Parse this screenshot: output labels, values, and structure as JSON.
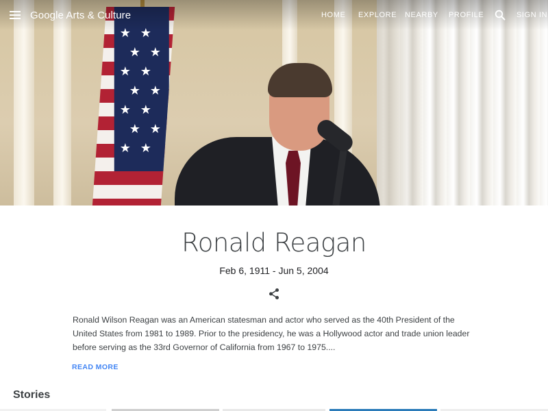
{
  "header": {
    "brand": "Google Arts & Culture",
    "nav": [
      "HOME",
      "EXPLORE",
      "NEARBY",
      "PROFILE"
    ],
    "sign_in": "SIGN IN"
  },
  "hero": {
    "image": "photo-of-ronald-reagan-at-podium-with-us-flag"
  },
  "entity": {
    "name": "Ronald Reagan",
    "dates": "Feb 6, 1911 - Jun 5, 2004",
    "bio": "Ronald Wilson Reagan was an American statesman and actor who served as the 40th President of the United States from 1981 to 1989. Prior to the presidency, he was a Hollywood actor and trade union leader before serving as the 33rd Governor of California from 1967 to 1975....",
    "read_more": "READ MORE"
  },
  "sections": {
    "stories_title": "Stories"
  },
  "colors": {
    "accent": "#4285f4",
    "text": "#3c4043"
  },
  "icons": [
    "menu-icon",
    "search-icon",
    "share-icon"
  ]
}
